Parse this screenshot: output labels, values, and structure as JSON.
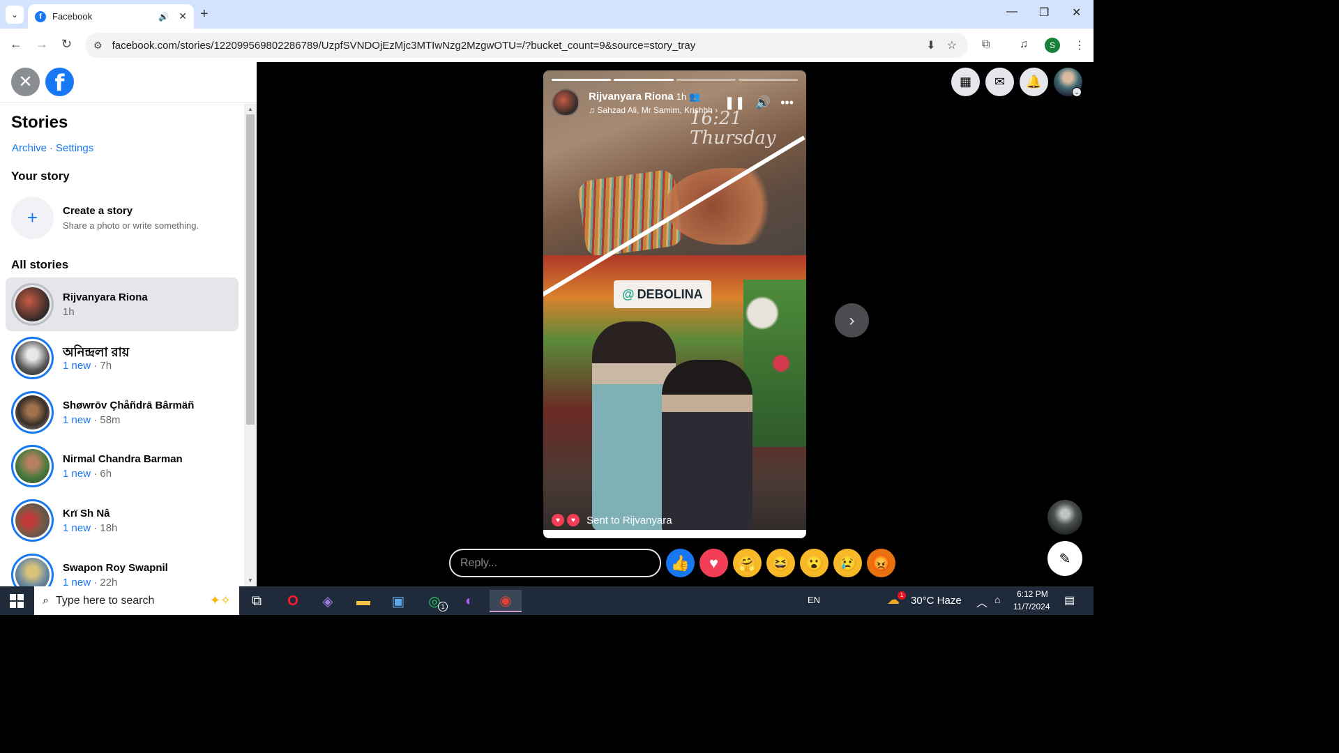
{
  "browser": {
    "tab_title": "Facebook",
    "url": "facebook.com/stories/122099569802286789/UzpfSVNDOjEzMjc3MTIwNzg2MzgwOTU=/?bucket_count=9&source=story_tray",
    "profile_initial": "S"
  },
  "sidebar": {
    "heading": "Stories",
    "archive_link": "Archive",
    "separator": "·",
    "settings_link": "Settings",
    "your_story_heading": "Your story",
    "create_title": "Create a story",
    "create_subtitle": "Share a photo or write something.",
    "all_stories_heading": "All stories",
    "stories": [
      {
        "name": "Rijvanyara Riona",
        "new": "",
        "time": "1h"
      },
      {
        "name": "অনিন্দ্রলা রায়",
        "new": "1 new",
        "time": " · 7h"
      },
      {
        "name": "Shøwrōv Çhåñdrā Bârmäñ",
        "new": "1 new",
        "time": " · 58m"
      },
      {
        "name": "Nirmal Chandra Barman",
        "new": "1 new",
        "time": " · 6h"
      },
      {
        "name": "Krï Sh Nâ",
        "new": "1 new",
        "time": " · 18h"
      },
      {
        "name": "Swapon Roy Swapnil",
        "new": "1 new",
        "time": " · 22h"
      }
    ]
  },
  "story": {
    "author": "Rijvanyara Riona",
    "time": "1h",
    "music": "Sahzad Ali, Mr Samim, Krishhh",
    "overlay_time": "16:21",
    "overlay_day": "Thursday",
    "mention": "DEBOLINA",
    "mention_at": "@",
    "sent_text": "Sent to Rijvanyara"
  },
  "reply": {
    "placeholder": "Reply..."
  },
  "reactions": [
    "like",
    "love",
    "care",
    "haha",
    "wow",
    "sad",
    "angry"
  ],
  "taskbar": {
    "search_placeholder": "Type here to search",
    "language": "EN",
    "weather": "30°C  Haze",
    "time": "6:12 PM",
    "date": "11/7/2024",
    "whatsapp_badge": "1",
    "weather_badge": "1"
  }
}
